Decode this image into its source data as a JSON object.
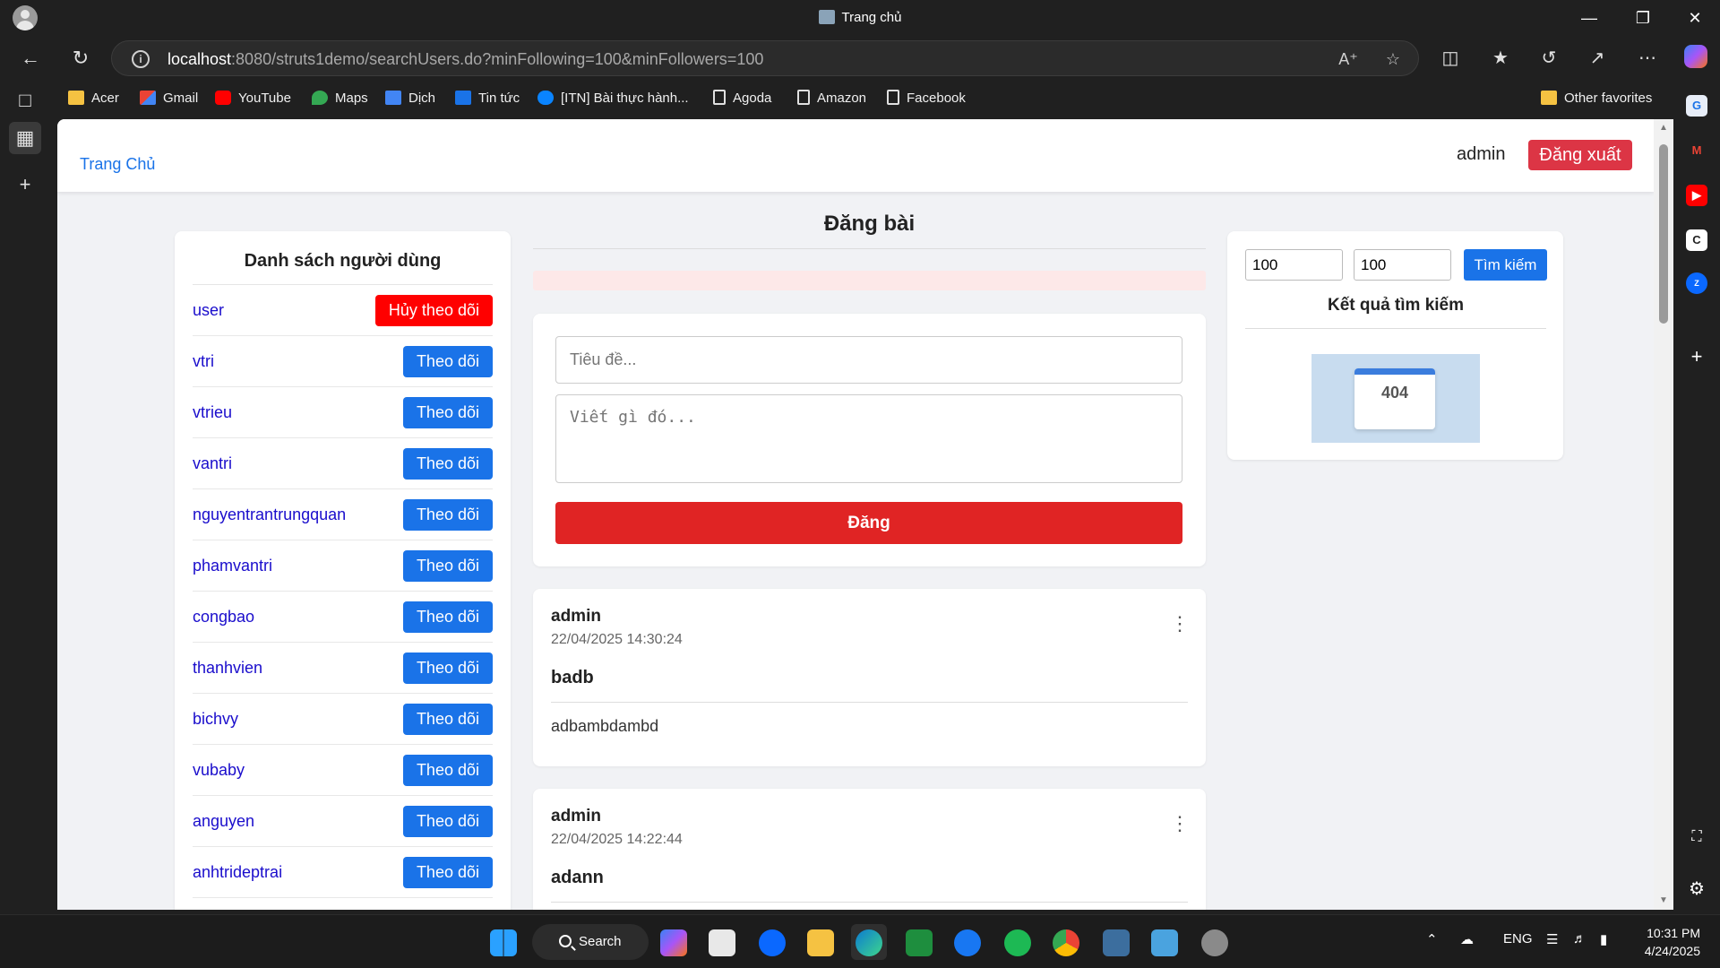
{
  "browser": {
    "tab_title": "Trang chủ",
    "url_host": "localhost",
    "url_rest": ":8080/struts1demo/searchUsers.do?minFollowing=100&minFollowers=100",
    "bookmarks": [
      "Acer",
      "Gmail",
      "YouTube",
      "Maps",
      "Dịch",
      "Tin tức",
      "[ITN] Bài thực hành...",
      "Agoda",
      "Amazon",
      "Facebook"
    ],
    "other_favorites": "Other favorites"
  },
  "header": {
    "home_link": "Trang Chủ",
    "username": "admin",
    "logout_label": "Đăng xuất"
  },
  "users_panel": {
    "title": "Danh sách người dùng",
    "users": [
      {
        "name": "user",
        "action": "Hủy theo dõi"
      },
      {
        "name": "vtri",
        "action": "Theo dõi"
      },
      {
        "name": "vtrieu",
        "action": "Theo dõi"
      },
      {
        "name": "vantri",
        "action": "Theo dõi"
      },
      {
        "name": "nguyentrantrungquan",
        "action": "Theo dõi"
      },
      {
        "name": "phamvantri",
        "action": "Theo dõi"
      },
      {
        "name": "congbao",
        "action": "Theo dõi"
      },
      {
        "name": "thanhvien",
        "action": "Theo dõi"
      },
      {
        "name": "bichvy",
        "action": "Theo dõi"
      },
      {
        "name": "vubaby",
        "action": "Theo dõi"
      },
      {
        "name": "anguyen",
        "action": "Theo dõi"
      },
      {
        "name": "anhtrideptrai",
        "action": "Theo dõi"
      }
    ]
  },
  "compose": {
    "heading": "Đăng bài",
    "title_placeholder": "Tiêu đề...",
    "body_placeholder": "Viết gì đó...",
    "submit_label": "Đăng"
  },
  "posts": [
    {
      "author": "admin",
      "time": "22/04/2025 14:30:24",
      "title": "badb",
      "body": "adbambdambd"
    },
    {
      "author": "admin",
      "time": "22/04/2025 14:22:44",
      "title": "adann",
      "body": ""
    }
  ],
  "search": {
    "min_following": "100",
    "min_followers": "100",
    "button_label": "Tìm kiếm",
    "results_title": "Kết quả tìm kiếm",
    "result_image_text": "404"
  },
  "taskbar": {
    "search_label": "Search",
    "lang": "ENG",
    "time": "10:31 PM",
    "date": "4/24/2025"
  },
  "colors": {
    "link_blue": "#1a73e8",
    "follow_blue": "#1a73e8",
    "unfollow_red": "#ff0000",
    "post_red": "#e02424",
    "logout_red": "#dc3545"
  }
}
